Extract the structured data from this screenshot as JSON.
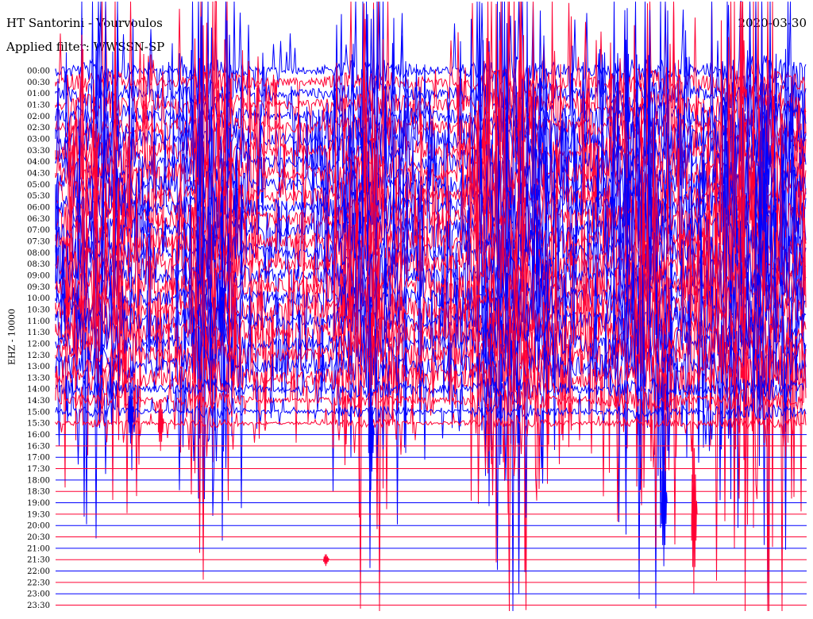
{
  "header": {
    "title": "HT Santorini - Vourvoulos",
    "filter": "Applied filter: WWSSN-SP",
    "date": "2020-03-30"
  },
  "chart_data": {
    "type": "line",
    "title": "HT Santorini - Vourvoulos",
    "subtitle": "Applied filter: WWSSN-SP",
    "ylabel": "EHZ - 10000",
    "date": "2020-03-30",
    "row_labels": [
      "00:00",
      "00:30",
      "01:00",
      "01:30",
      "02:00",
      "02:30",
      "03:00",
      "03:30",
      "04:00",
      "04:30",
      "05:00",
      "05:30",
      "06:00",
      "06:30",
      "07:00",
      "07:30",
      "08:00",
      "08:30",
      "09:00",
      "09:30",
      "10:00",
      "10:30",
      "11:00",
      "11:30",
      "12:00",
      "12:30",
      "13:00",
      "13:30",
      "14:00",
      "14:30",
      "15:00",
      "15:30",
      "16:00",
      "16:30",
      "17:00",
      "17:30",
      "18:00",
      "18:30",
      "19:00",
      "19:30",
      "20:00",
      "20:30",
      "21:00",
      "21:30",
      "22:00",
      "22:30",
      "23:00",
      "23:30"
    ],
    "series_colors": [
      "#0000ff",
      "#ff0033"
    ],
    "color_pattern": "alternating rows starting blue",
    "active_rows_end": "15:30",
    "events": [
      {
        "row": "15:00",
        "time_fraction": 0.1,
        "amplitude": 40
      },
      {
        "row": "15:30",
        "time_fraction": 0.14,
        "amplitude": 35
      },
      {
        "row": "16:00",
        "time_fraction": 0.42,
        "amplitude": 70
      },
      {
        "row": "19:00",
        "time_fraction": 0.81,
        "amplitude": 80
      },
      {
        "row": "19:30",
        "time_fraction": 0.85,
        "amplitude": 100
      },
      {
        "row": "21:30",
        "time_fraction": 0.36,
        "amplitude": 8
      }
    ]
  }
}
